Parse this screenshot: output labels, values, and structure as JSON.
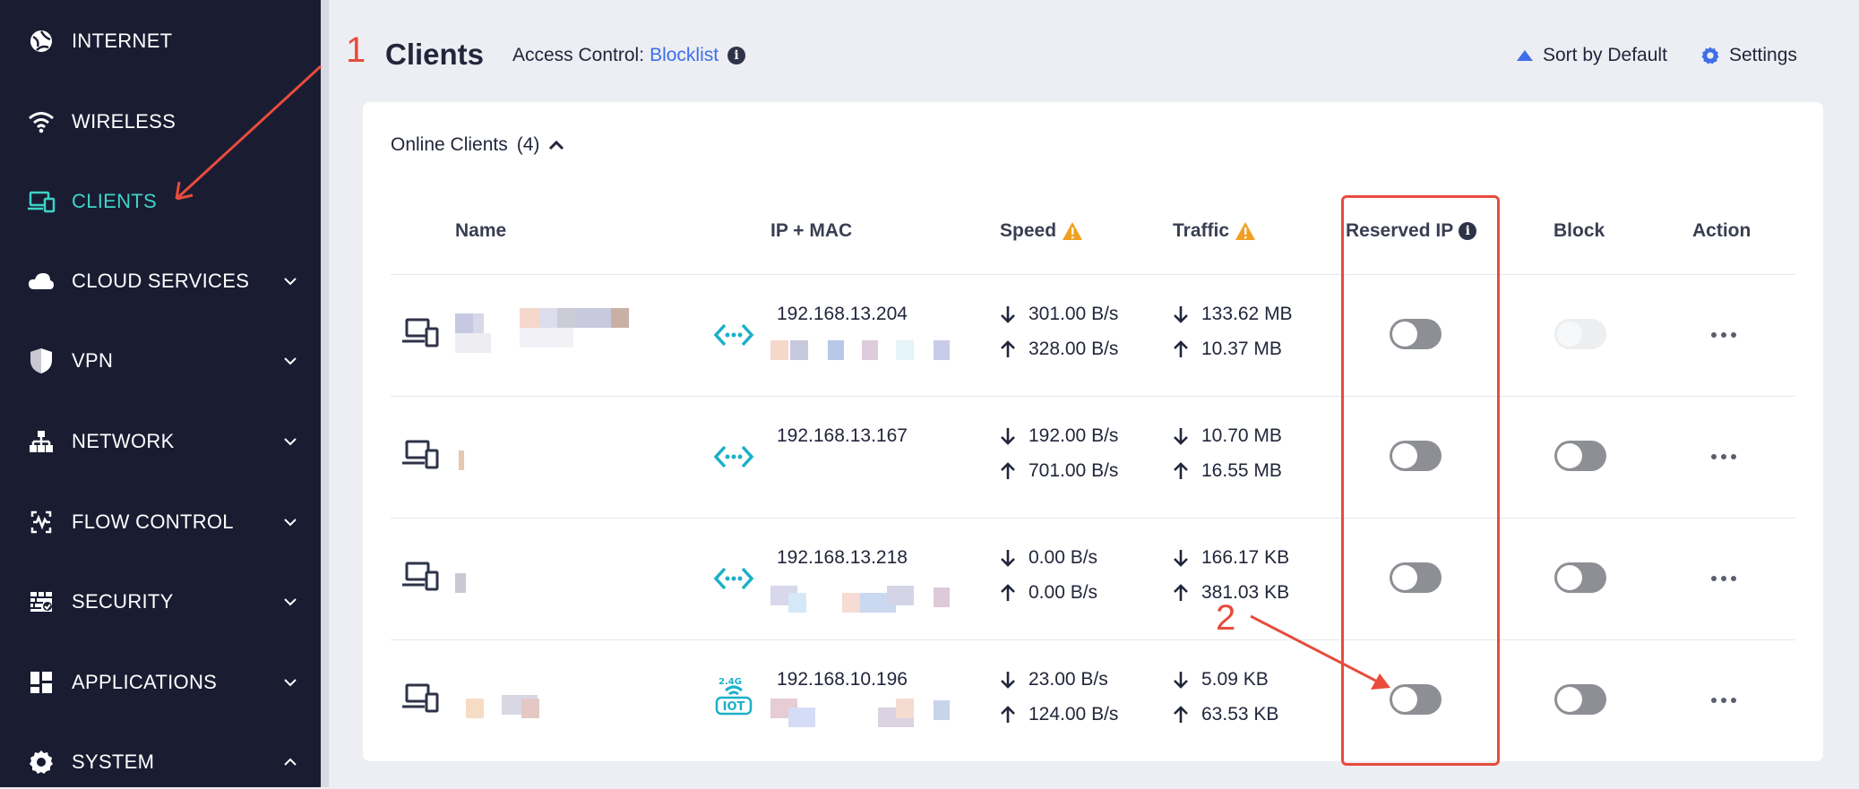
{
  "sidebar": {
    "items": [
      {
        "label": "INTERNET",
        "icon": "globe-icon",
        "expand": ""
      },
      {
        "label": "WIRELESS",
        "icon": "wifi-icon",
        "expand": ""
      },
      {
        "label": "CLIENTS",
        "icon": "devices-icon",
        "expand": "",
        "active": true
      },
      {
        "label": "CLOUD SERVICES",
        "icon": "cloud-icon",
        "expand": "down"
      },
      {
        "label": "VPN",
        "icon": "shield-icon",
        "expand": "down"
      },
      {
        "label": "NETWORK",
        "icon": "network-icon",
        "expand": "down"
      },
      {
        "label": "FLOW CONTROL",
        "icon": "flow-control-icon",
        "expand": "down"
      },
      {
        "label": "SECURITY",
        "icon": "firewall-icon",
        "expand": "down"
      },
      {
        "label": "APPLICATIONS",
        "icon": "apps-grid-icon",
        "expand": "down"
      },
      {
        "label": "SYSTEM",
        "icon": "gear-icon",
        "expand": "up"
      }
    ]
  },
  "header": {
    "step_number": "1",
    "title": "Clients",
    "access_control_label": "Access Control:",
    "access_control_value": "Blocklist",
    "sort_label": "Sort by Default",
    "settings_label": "Settings"
  },
  "online_clients": {
    "label": "Online Clients",
    "count": "(4)"
  },
  "columns": {
    "name": "Name",
    "ip_mac": "IP + MAC",
    "speed": "Speed",
    "traffic": "Traffic",
    "reserved_ip": "Reserved IP",
    "block": "Block",
    "action": "Action"
  },
  "clients": [
    {
      "ip": "192.168.13.204",
      "down_speed": "301.00 B/s",
      "up_speed": "328.00 B/s",
      "down_traffic": "133.62 MB",
      "up_traffic": "10.37 MB",
      "conn": "ethernet-icon",
      "reserved_ip": false,
      "block": false,
      "block_disabled": true
    },
    {
      "ip": "192.168.13.167",
      "down_speed": "192.00 B/s",
      "up_speed": "701.00 B/s",
      "down_traffic": "10.70 MB",
      "up_traffic": "16.55 MB",
      "conn": "ethernet-icon",
      "reserved_ip": false,
      "block": false,
      "block_disabled": false
    },
    {
      "ip": "192.168.13.218",
      "down_speed": "0.00 B/s",
      "up_speed": "0.00 B/s",
      "down_traffic": "166.17 KB",
      "up_traffic": "381.03 KB",
      "conn": "ethernet-icon",
      "reserved_ip": false,
      "block": false,
      "block_disabled": false
    },
    {
      "ip": "192.168.10.196",
      "down_speed": "23.00 B/s",
      "up_speed": "124.00 B/s",
      "down_traffic": "5.09 KB",
      "up_traffic": "63.53 KB",
      "conn": "iot-2.4g-icon",
      "reserved_ip": false,
      "block": false,
      "block_disabled": false
    }
  ],
  "iot_badge": {
    "band": "2.4G",
    "label": "IOT"
  },
  "annotation": {
    "step_number": "2"
  },
  "colors": {
    "sidebar_bg": "#1a1c32",
    "active_teal": "#3ed3c8",
    "link_blue": "#3f6ee8",
    "warning": "#f0a020",
    "annotation_red": "#e74c3c",
    "toggle_off": "#8d8f95"
  }
}
